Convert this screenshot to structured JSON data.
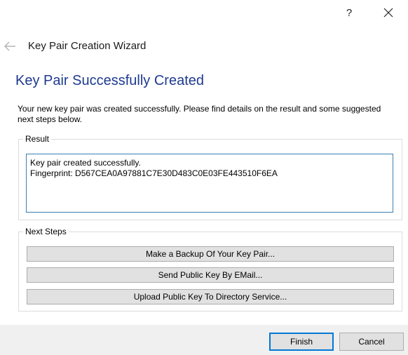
{
  "titlebar": {
    "help_label": "?",
    "close_icon": "close-icon"
  },
  "header": {
    "back_icon": "back-arrow-icon",
    "wizard_title": "Key Pair Creation Wizard"
  },
  "page": {
    "title": "Key Pair Successfully Created",
    "description": "Your new key pair was created successfully. Please find details on the result and some suggested next steps below."
  },
  "result": {
    "group_label": "Result",
    "text": "Key pair created successfully.\nFingerprint: D567CEA0A97881C7E30D483C0E03FE443510F6EA"
  },
  "next_steps": {
    "group_label": "Next Steps",
    "buttons": [
      {
        "label": "Make a Backup Of Your Key Pair..."
      },
      {
        "label": "Send Public Key By EMail..."
      },
      {
        "label": "Upload Public Key To Directory Service..."
      }
    ]
  },
  "footer": {
    "finish_label": "Finish",
    "cancel_label": "Cancel"
  },
  "colors": {
    "title_blue": "#1e3a8f",
    "focus_blue": "#0078d7",
    "result_border": "#3c7fb1",
    "footer_bg": "#f0f0f0"
  }
}
